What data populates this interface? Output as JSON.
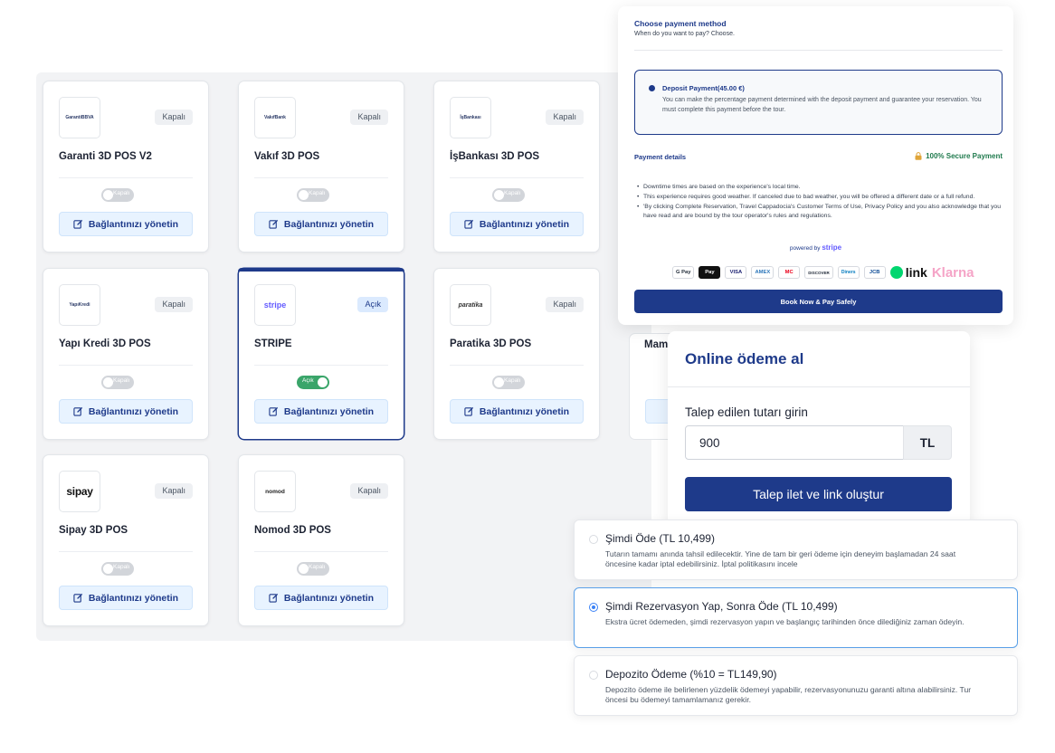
{
  "pos_cards": [
    {
      "name": "Garanti 3D POS V2",
      "logo": "GarantiBBVA",
      "status": "Kapalı",
      "toggle": "Kapalı",
      "manage": "Bağlantınızı yönetin",
      "active": false
    },
    {
      "name": "Vakıf 3D POS",
      "logo": "VakıfBank",
      "status": "Kapalı",
      "toggle": "Kapalı",
      "manage": "Bağlantınızı yönetin",
      "active": false
    },
    {
      "name": "İşBankası 3D POS",
      "logo": "İşBankası",
      "status": "Kapalı",
      "toggle": "Kapalı",
      "manage": "Bağlantınızı yönetin",
      "active": false
    },
    {
      "name": "Yapı Kredi 3D POS",
      "logo": "YapıKredi",
      "status": "Kapalı",
      "toggle": "Kapalı",
      "manage": "Bağlantınızı yönetin",
      "active": false
    },
    {
      "name": "STRIPE",
      "logo": "stripe",
      "status": "Açık",
      "toggle": "Açık",
      "manage": "Bağlantınızı yönetin",
      "active": true
    },
    {
      "name": "Paratika 3D POS",
      "logo": "paratika",
      "status": "Kapalı",
      "toggle": "Kapalı",
      "manage": "Bağlantınızı yönetin",
      "active": false
    },
    {
      "name": "Sipay 3D POS",
      "logo": "sipay",
      "status": "Kapalı",
      "toggle": "Kapalı",
      "manage": "Bağlantınızı yönetin",
      "active": false
    },
    {
      "name": "Nomod 3D POS",
      "logo": "nomod",
      "status": "Kapalı",
      "toggle": "Kapalı",
      "manage": "Bağlantınızı yönetin",
      "active": false
    }
  ],
  "ghost_card": {
    "name_fragment": "Mam"
  },
  "payment_method": {
    "title": "Choose payment method",
    "subtitle": "When do you want to pay? Choose.",
    "deposit_title": "Deposit Payment(45.00 €)",
    "deposit_desc": "You can make the percentage payment determined with the deposit payment and guarantee your reservation. You must complete this payment before the tour.",
    "details_label": "Payment details",
    "secure_label": "100% Secure Payment",
    "notes": [
      "Downtime times are based on the experience's local time.",
      "This experience requires good weather. If canceled due to bad weather, you will be offered a different date or a full refund.",
      "'By clicking Complete Reservation, Travel Cappadocia's Customer Terms of Use, Privacy Policy and you also acknowledge that you have read and are bound by the tour operator's rules and regulations."
    ],
    "powered_by": "powered by",
    "powered_brand": "stripe",
    "wallets": [
      "G Pay",
      "Pay",
      "VISA",
      "AMEX",
      "MC",
      "DISCOVER",
      "Diners",
      "JCB"
    ],
    "link_label": "link",
    "klarna_label": "Klarna",
    "book_button": "Book Now & Pay Safely"
  },
  "online_payment": {
    "title": "Online ödeme al",
    "amount_label": "Talep edilen tutarı girin",
    "amount_value": "900",
    "currency": "TL",
    "create_button": "Talep ilet ve link oluştur"
  },
  "options": [
    {
      "title": "Şimdi Öde (TL 10,499)",
      "desc": "Tutarın tamamı anında tahsil edilecektir. Yine de tam bir geri ödeme için deneyim başlamadan 24 saat öncesine kadar iptal edebilirsiniz. İptal politikasını incele",
      "selected": false
    },
    {
      "title": "Şimdi Rezervasyon Yap, Sonra Öde (TL 10,499)",
      "desc": "Ekstra ücret ödemeden, şimdi rezervasyon yapın ve başlangıç tarihinden önce dilediğiniz zaman ödeyin.",
      "selected": true
    },
    {
      "title": "Depozito Ödeme (%10 = TL149,90)",
      "desc": "Depozito ödeme ile belirlenen yüzdelik ödemeyi yapabilir, rezervasyonunuzu garanti altına alabilirsiniz. Tur öncesi bu ödemeyi tamamlamanız gerekir.",
      "selected": false
    }
  ],
  "colors": {
    "primary": "#1e3a8a",
    "toggle_on": "#3aa56a",
    "secure": "#1f7a4d",
    "stripe": "#635bff",
    "klarna": "#f5a4c7"
  }
}
